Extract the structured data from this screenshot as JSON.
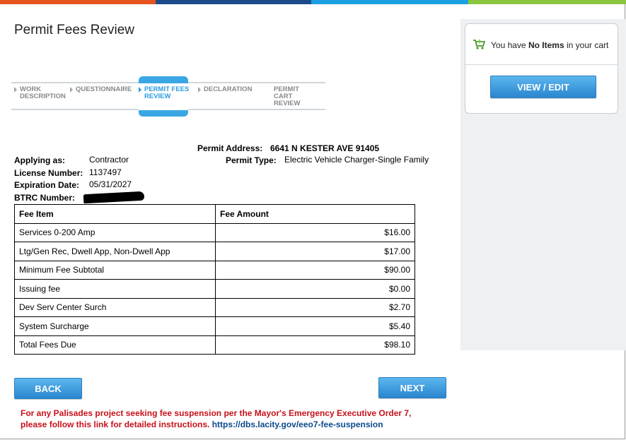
{
  "top_bar_colors": [
    "#e8541f",
    "#1c4b8a",
    "#1ba0e2",
    "#8cc63f"
  ],
  "page_title": "Permit Fees Review",
  "steps": [
    {
      "line1": "WORK",
      "line2": "DESCRIPTION",
      "line3": ""
    },
    {
      "line1": "QUESTIONNAIRE",
      "line2": "",
      "line3": ""
    },
    {
      "line1": "PERMIT FEES",
      "line2": "REVIEW",
      "line3": ""
    },
    {
      "line1": "DECLARATION",
      "line2": "",
      "line3": ""
    },
    {
      "line1": "PERMIT",
      "line2": "CART",
      "line3": "REVIEW"
    }
  ],
  "active_step_color": "#2b9be0",
  "info": {
    "applying_as_label": "Applying as:",
    "applying_as_value": "Contractor",
    "license_label": "License Number:",
    "license_value": "1137497",
    "expiration_label": "Expiration Date:",
    "expiration_value": "05/31/2027",
    "btrc_label": "BTRC Number:",
    "permit_address_label": "Permit Address:",
    "permit_address_value": "6641 N KESTER AVE 91405",
    "permit_type_label": "Permit Type:",
    "permit_type_value": "Electric Vehicle Charger-Single Family"
  },
  "fees_table": {
    "headers": [
      "Fee Item",
      "Fee Amount"
    ],
    "rows": [
      {
        "item": "Services 0-200 Amp",
        "amount": "$16.00"
      },
      {
        "item": "Ltg/Gen Rec, Dwell App, Non-Dwell App",
        "amount": "$17.00"
      },
      {
        "item": "Minimum Fee Subtotal",
        "amount": "$90.00"
      },
      {
        "item": "Issuing fee",
        "amount": "$0.00"
      },
      {
        "item": "Dev Serv Center Surch",
        "amount": "$2.70"
      },
      {
        "item": "System Surcharge",
        "amount": "$5.40"
      },
      {
        "item": "Total Fees Due",
        "amount": "$98.10"
      }
    ]
  },
  "buttons": {
    "back": "BACK",
    "next": "NEXT",
    "view_edit": "VIEW / EDIT"
  },
  "notice": {
    "line1": "For any Palisades project seeking fee suspension per the Mayor's Emergency Executive Order 7,",
    "line2": "please follow this link for detailed instructions.",
    "link": "https://dbs.lacity.gov/eeo7-fee-suspension"
  },
  "cart": {
    "prefix": "You have ",
    "emphasis": "No Items",
    "suffix": " in your cart",
    "icon": "shopping-cart-icon"
  }
}
